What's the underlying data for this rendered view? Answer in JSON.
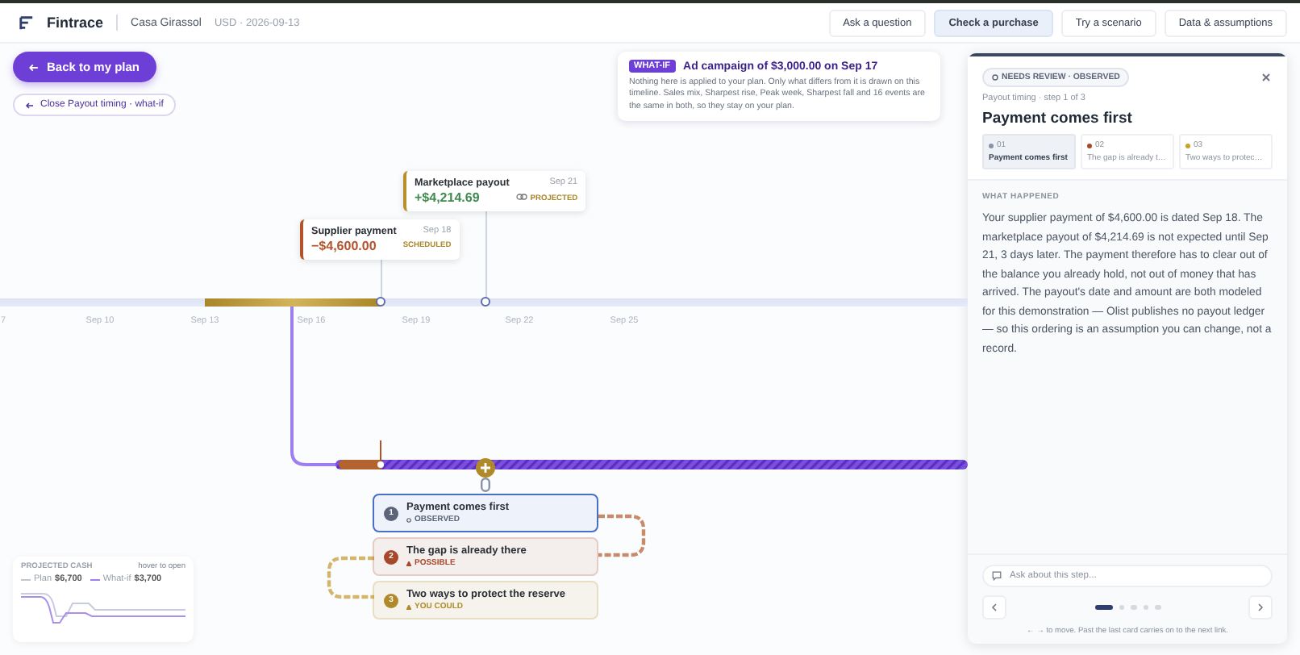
{
  "header": {
    "brand": "Fintrace",
    "workspace": "Casa Girassol",
    "meta": "USD · 2026-09-13",
    "nav": [
      {
        "label": "Ask a question",
        "selected": false
      },
      {
        "label": "Check a purchase",
        "selected": true
      },
      {
        "label": "Try a scenario",
        "selected": false
      },
      {
        "label": "Data & assumptions",
        "selected": false
      }
    ]
  },
  "back_button": "Back to my plan",
  "close_chip": "Close Payout timing · what-if",
  "whatif_banner": {
    "badge": "WHAT-IF",
    "title": "Ad campaign of $3,000.00 on Sep 17",
    "body": "Nothing here is applied to your plan. Only what differs from it is drawn on this timeline. Sales mix, Sharpest rise, Peak week, Sharpest fall and 16 events are the same in both, so they stay on your plan."
  },
  "timeline": {
    "ticks": [
      "7",
      "Sep 10",
      "Sep 13",
      "Sep 16",
      "Sep 19",
      "Sep 22",
      "Sep 25"
    ],
    "events": [
      {
        "kind": "outflow",
        "title": "Supplier payment",
        "date": "Sep 18",
        "amount": "−$4,600.00",
        "status": "SCHEDULED"
      },
      {
        "kind": "inflow",
        "title": "Marketplace payout",
        "date": "Sep 21",
        "amount": "+$4,214.69",
        "status": "PROJECTED"
      }
    ]
  },
  "chain": [
    {
      "number": "1",
      "title": "Payment comes first",
      "status": "OBSERVED",
      "color": "#5b6478",
      "selected": true
    },
    {
      "number": "2",
      "title": "The gap is already there",
      "status": "POSSIBLE",
      "color": "#a8482a",
      "selected": false
    },
    {
      "number": "3",
      "title": "Two ways to protect the reserve",
      "status": "YOU COULD",
      "color": "#b08a2a",
      "selected": false
    }
  ],
  "mini_cash": {
    "title": "PROJECTED CASH",
    "hint": "hover to open",
    "legend": [
      {
        "label": "Plan",
        "value": "$6,700"
      },
      {
        "label": "What-if",
        "value": "$3,700"
      }
    ]
  },
  "panel": {
    "status_chip": "NEEDS REVIEW · OBSERVED",
    "breadcrumb": "Payout timing · step 1 of 3",
    "title": "Payment comes first",
    "steps": [
      {
        "number": "01",
        "label": "Payment comes first",
        "color": "#8a93a6",
        "selected": true
      },
      {
        "number": "02",
        "label": "The gap is already t…",
        "color": "#a8482a",
        "selected": false
      },
      {
        "number": "03",
        "label": "Two ways to protec…",
        "color": "#c9a227",
        "selected": false
      }
    ],
    "section_label": "WHAT HAPPENED",
    "body": "Your supplier payment of $4,600.00 is dated Sep 18. The marketplace payout of $4,214.69 is not expected until Sep 21, 3 days later. The payment therefore has to clear out of the balance you already hold, not out of money that has arrived. The payout's date and amount are both modeled for this demonstration — Olist publishes no payout ledger — so this ordering is an assumption you can change, not a record.",
    "ask_placeholder": "Ask about this step...",
    "pages": [
      {
        "selected": true
      },
      {
        "selected": false
      },
      {
        "selected": false
      },
      {
        "selected": false
      },
      {
        "selected": false
      }
    ],
    "hint": "← → to move. Past the last card carries on to the next link."
  }
}
